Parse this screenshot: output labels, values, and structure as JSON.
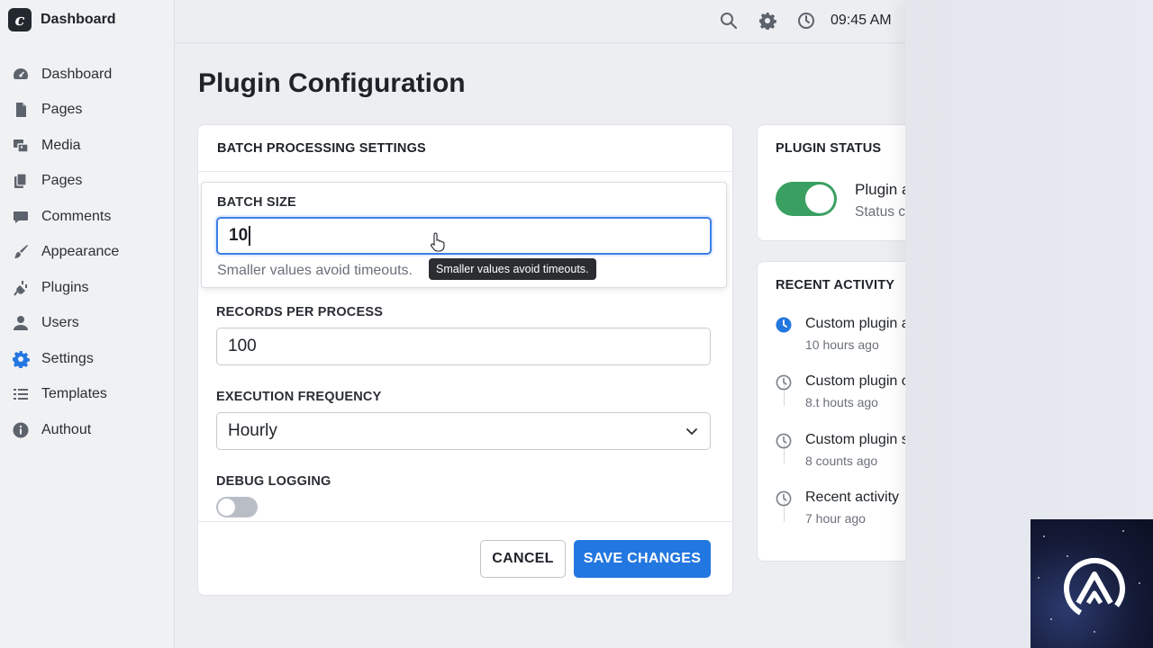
{
  "brand": {
    "logo_letter": "c",
    "title": "Dashboard"
  },
  "sidebar": {
    "items": [
      {
        "label": "Dashboard",
        "icon": "speedometer-icon"
      },
      {
        "label": "Pages",
        "icon": "page-icon"
      },
      {
        "label": "Media",
        "icon": "media-icon"
      },
      {
        "label": "Pages",
        "icon": "pages-stack-icon"
      },
      {
        "label": "Comments",
        "icon": "comment-icon"
      },
      {
        "label": "Appearance",
        "icon": "paintbrush-icon"
      },
      {
        "label": "Plugins",
        "icon": "plug-icon"
      },
      {
        "label": "Users",
        "icon": "user-icon"
      },
      {
        "label": "Settings",
        "icon": "gear-icon",
        "active": true
      },
      {
        "label": "Templates",
        "icon": "list-icon"
      },
      {
        "label": "Authout",
        "icon": "info-icon"
      }
    ]
  },
  "topbar": {
    "time": "09:45 AM"
  },
  "page": {
    "title": "Plugin Configuration"
  },
  "batch": {
    "card_title": "BATCH PROCESSING SETTINGS",
    "batch_size_label": "BATCH SIZE",
    "batch_size_value": "10",
    "batch_size_help": "Smaller values avoid timeouts.",
    "tooltip": "Smaller values avoid timeouts.",
    "records_label": "RECORDS PER PROCESS",
    "records_value": "100",
    "frequency_label": "EXECUTION FREQUENCY",
    "frequency_value": "Hourly",
    "debug_label": "DEBUG LOGGING",
    "debug_on": false,
    "cancel_label": "CANCEL",
    "save_label": "SAVE CHANGES"
  },
  "status": {
    "card_title": "PLUGIN STATUS",
    "name": "Plugin a",
    "sub": "Status c",
    "enabled": true
  },
  "activity": {
    "card_title": "RECENT ACTIVITY",
    "items": [
      {
        "title": "Custom plugin a",
        "time": "10 hours ago",
        "current": true
      },
      {
        "title": "Custom plugin c",
        "time": "8.t houts ago",
        "current": false
      },
      {
        "title": "Custom plugin s",
        "time": "8 counts ago",
        "current": false
      },
      {
        "title": "Recent activity",
        "time": "7 hour ago",
        "current": false
      }
    ]
  },
  "colors": {
    "accent": "#2377e0",
    "toggle_on": "#3aa061",
    "toggle_off": "#b9bec6",
    "sidebar_bg": "#f0f1f3"
  }
}
